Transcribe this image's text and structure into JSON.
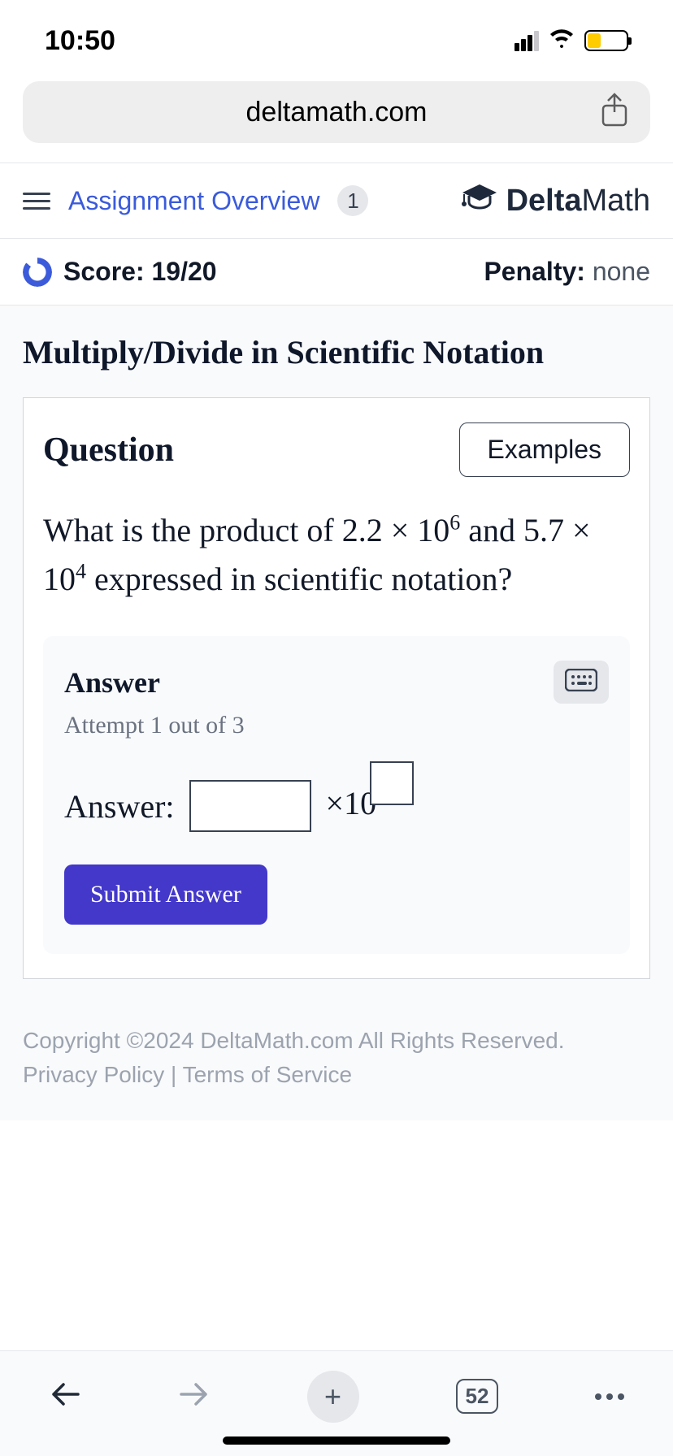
{
  "status": {
    "time": "10:50"
  },
  "url": "deltamath.com",
  "header": {
    "assignment_link": "Assignment Overview",
    "badge": "1",
    "logo_delta": "Delta",
    "logo_math": "Math"
  },
  "score": {
    "label": "Score: 19/20",
    "penalty_label": "Penalty:",
    "penalty_value": " none"
  },
  "page_title": "Multiply/Divide in Scientific Notation",
  "question": {
    "heading": "Question",
    "examples_btn": "Examples",
    "text_part1": "What is the product of ",
    "num1_coef": "2.2",
    "times": " × ",
    "ten": "10",
    "num1_exp": "6",
    "and": " and ",
    "num2_coef": "5.7",
    "num2_exp": "4",
    "text_part2": " expressed in scientific notation?"
  },
  "answer": {
    "heading": "Answer",
    "attempt": "Attempt 1 out of 3",
    "label": "Answer:",
    "times10": "×10",
    "submit": "Submit Answer"
  },
  "footer": {
    "copyright": "Copyright ©2024 DeltaMath.com All Rights Reserved.",
    "links": "Privacy Policy | Terms of Service"
  },
  "toolbar": {
    "tabs": "52"
  }
}
